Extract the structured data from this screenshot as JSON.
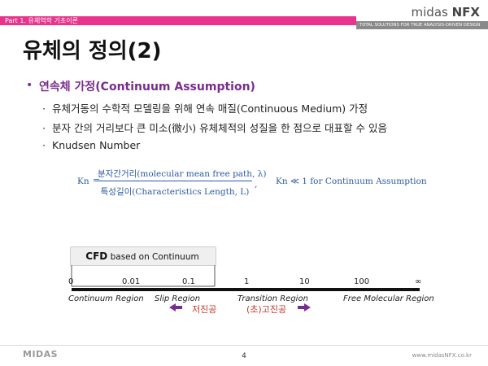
{
  "header": {
    "part_label": "Part 1. 유체역학 기초이론",
    "brand_prefix": "midas",
    "brand_suffix": "NFX",
    "tagline": "TOTAL SOLUTIONS FOR TRUE ANALYSIS-DRIVEN DESIGN",
    "accent_color": "#e9338c"
  },
  "title": "유체의 정의(2)",
  "section": {
    "bullet": "•",
    "heading": "연속체 가정(Continuum Assumption)",
    "items": [
      "유체거동의 수학적 모델링을 위해 연속 매질(Continuous Medium) 가정",
      "분자 간의 거리보다 큰 미소(微小) 유체체적의 성질을 한 점으로 대표할 수 있음",
      "Knudsen Number"
    ],
    "item_marker": "·"
  },
  "formula": {
    "lhs": "Kn",
    "eq": "=",
    "numerator": "분자간거리(molecular mean free path, λ)",
    "denominator": "특성길이(Characteristics Length, L)",
    "comma": ",",
    "condition": "Kn ≪ 1 for Continuum Assumption"
  },
  "diagram": {
    "cfd_bold": "CFD",
    "cfd_rest": "based on Continuum",
    "ticks": [
      "0",
      "0.01",
      "0.1",
      "1",
      "10",
      "100",
      "∞"
    ],
    "regions": [
      "Continuum Region",
      "Slip Region",
      "Transition Region",
      "Free Molecular Region"
    ],
    "left_arrow_label": "저진공",
    "right_arrow_label": "(초)고진공",
    "arrow_color": "#7a2b8f"
  },
  "footer": {
    "logo": "MIDAS",
    "page_number": "4",
    "site": "www.midasNFX.co.kr"
  }
}
